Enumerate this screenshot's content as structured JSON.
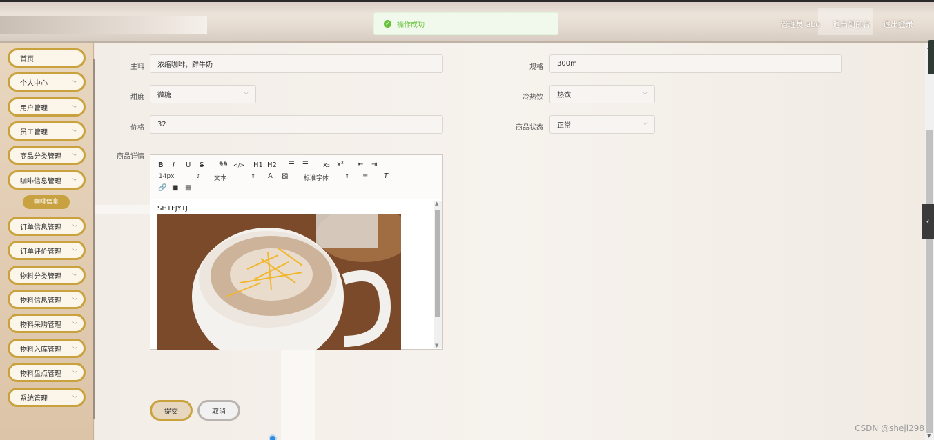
{
  "header": {
    "admin_label": "管理员 abo",
    "back_to_front": "退出到前台",
    "logout": "退出登录"
  },
  "toast": {
    "message": "操作成功"
  },
  "sidebar": {
    "items": [
      {
        "label": "首页",
        "expandable": false
      },
      {
        "label": "个人中心",
        "expandable": true
      },
      {
        "label": "用户管理",
        "expandable": true
      },
      {
        "label": "员工管理",
        "expandable": true
      },
      {
        "label": "商品分类管理",
        "expandable": true
      },
      {
        "label": "咖啡信息管理",
        "expandable": true
      },
      {
        "label": "订单信息管理",
        "expandable": true
      },
      {
        "label": "订单评价管理",
        "expandable": true
      },
      {
        "label": "物料分类管理",
        "expandable": true
      },
      {
        "label": "物料信息管理",
        "expandable": true
      },
      {
        "label": "物料采购管理",
        "expandable": true
      },
      {
        "label": "物料入库管理",
        "expandable": true
      },
      {
        "label": "物料盘点管理",
        "expandable": true
      },
      {
        "label": "系统管理",
        "expandable": true
      }
    ],
    "sub_item": "咖啡信息"
  },
  "form": {
    "ingredients": {
      "label": "主料",
      "value": "浓缩咖啡，鲜牛奶"
    },
    "spec": {
      "label": "规格",
      "value": "300m"
    },
    "sweetness": {
      "label": "甜度",
      "value": "微糖"
    },
    "temperature": {
      "label": "冷热饮",
      "value": "热饮"
    },
    "price": {
      "label": "价格",
      "value": "32"
    },
    "status": {
      "label": "商品状态",
      "value": "正常"
    },
    "details": {
      "label": "商品详情"
    }
  },
  "editor": {
    "toolbar": {
      "bold": "B",
      "italic": "I",
      "underline": "U",
      "strike": "S",
      "quote": "99",
      "code": "</>",
      "h1": "H1",
      "h2": "H2",
      "sub": "x₂",
      "sup": "x²",
      "font_size": "14px",
      "text_type": "文本",
      "font_family": "标准字体"
    },
    "content_text": "SHTFJYTJ"
  },
  "buttons": {
    "submit": "提交",
    "cancel": "取消"
  },
  "watermark": "CSDN @sheji298",
  "colors": {
    "accent": "#c9a23e",
    "success": "#67c23a"
  }
}
